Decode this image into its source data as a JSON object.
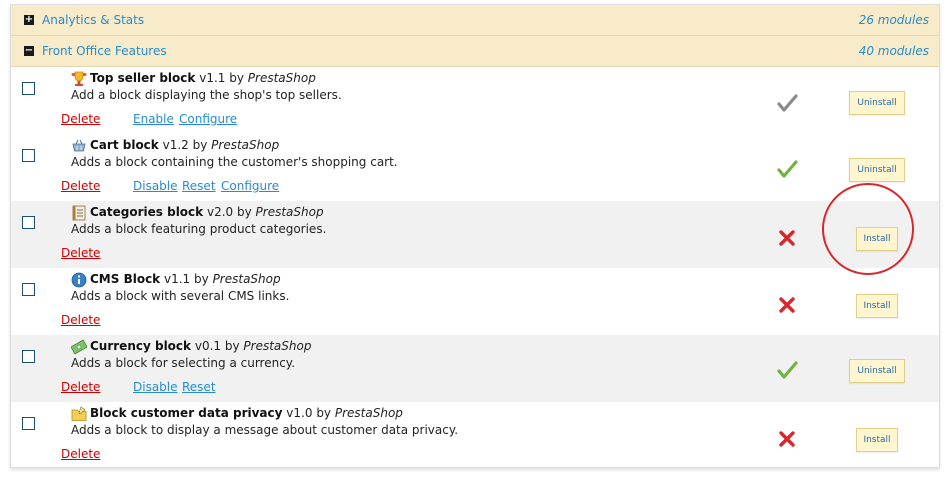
{
  "categories": [
    {
      "name": "Analytics & Stats",
      "count": "26 modules",
      "toggle": "+"
    },
    {
      "name": "Front Office Features",
      "count": "40 modules",
      "toggle": "−"
    }
  ],
  "by_label": "by",
  "modules": [
    {
      "name": "Top seller block",
      "version": "v1.1",
      "author": "PrestaShop",
      "description": "Add a block displaying the shop's top sellers.",
      "icon": "trophy-icon",
      "status": "inactive-check",
      "button": "Uninstall",
      "actions": [
        "Delete",
        "Enable",
        "Configure"
      ]
    },
    {
      "name": "Cart block",
      "version": "v1.2",
      "author": "PrestaShop",
      "description": "Adds a block containing the customer's shopping cart.",
      "icon": "basket-icon",
      "status": "active-check",
      "button": "Uninstall",
      "actions": [
        "Delete",
        "Disable",
        "Reset",
        "Configure"
      ]
    },
    {
      "name": "Categories block",
      "version": "v2.0",
      "author": "PrestaShop",
      "description": "Adds a block featuring product categories.",
      "icon": "list-icon",
      "status": "not-installed-cross",
      "button": "Install",
      "actions": [
        "Delete"
      ]
    },
    {
      "name": "CMS Block",
      "version": "v1.1",
      "author": "PrestaShop",
      "description": "Adds a block with several CMS links.",
      "icon": "info-icon",
      "status": "not-installed-cross",
      "button": "Install",
      "actions": [
        "Delete"
      ]
    },
    {
      "name": "Currency block",
      "version": "v0.1",
      "author": "PrestaShop",
      "description": "Adds a block for selecting a currency.",
      "icon": "money-icon",
      "status": "active-check",
      "button": "Uninstall",
      "actions": [
        "Delete",
        "Disable",
        "Reset"
      ]
    },
    {
      "name": "Block customer data privacy",
      "version": "v1.0",
      "author": "PrestaShop",
      "description": "Adds a block to display a message about customer data privacy.",
      "icon": "folder-icon",
      "status": "not-installed-cross",
      "button": "Install",
      "actions": [
        "Delete"
      ]
    }
  ],
  "colors": {
    "link": "#268ccd",
    "delete": "#cc0000",
    "check_active": "#6fb341",
    "check_inactive": "#8a8a8a",
    "cross": "#d9262b",
    "header_bg": "#f7ebc9"
  }
}
